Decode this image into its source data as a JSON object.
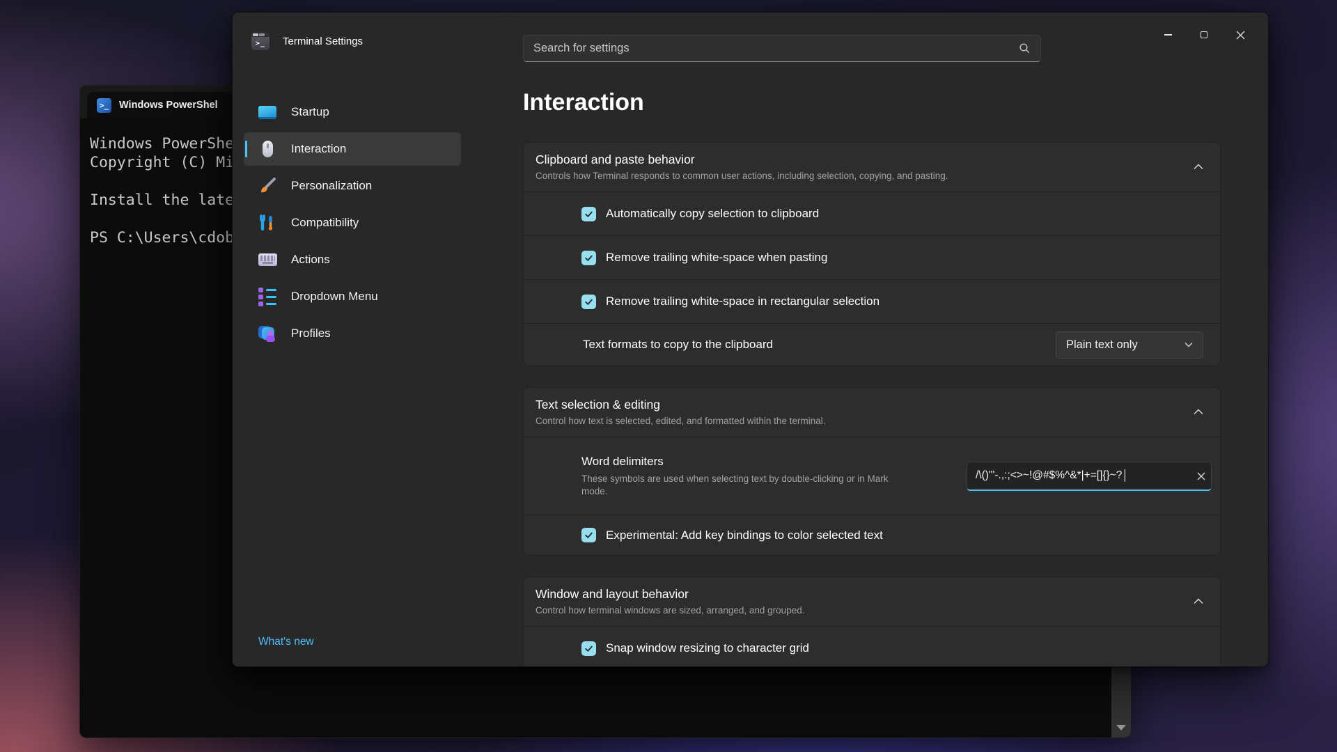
{
  "colors": {
    "accent": "#4cc2ff",
    "checkbox_fill": "#97dfef",
    "window_bg": "#282828",
    "card_bg": "#2d2d2d",
    "terminal_bg": "#0c0c0c"
  },
  "powershell": {
    "tab_title": "Windows PowerShel",
    "lines": [
      "Windows PowerShe",
      "Copyright (C) Mi",
      "",
      "Install the late",
      "",
      "PS C:\\Users\\cdob"
    ]
  },
  "titlebar": {
    "app_title": "Terminal Settings"
  },
  "search": {
    "placeholder": "Search for settings"
  },
  "sidebar": {
    "items": [
      {
        "label": "Startup",
        "icon": "monitor-icon",
        "selected": false
      },
      {
        "label": "Interaction",
        "icon": "mouse-icon",
        "selected": true
      },
      {
        "label": "Personalization",
        "icon": "paintbrush-icon",
        "selected": false
      },
      {
        "label": "Compatibility",
        "icon": "tools-icon",
        "selected": false
      },
      {
        "label": "Actions",
        "icon": "keyboard-icon",
        "selected": false
      },
      {
        "label": "Dropdown Menu",
        "icon": "list-icon",
        "selected": false
      },
      {
        "label": "Profiles",
        "icon": "profiles-icon",
        "selected": false
      }
    ],
    "whats_new_label": "What's new"
  },
  "page": {
    "title": "Interaction",
    "clipboard_card": {
      "title": "Clipboard and paste behavior",
      "subtitle": "Controls how Terminal responds to common user actions, including selection, copying, and pasting.",
      "rows": [
        {
          "label": "Automatically copy selection to clipboard",
          "checked": true
        },
        {
          "label": "Remove trailing white-space when pasting",
          "checked": true
        },
        {
          "label": "Remove trailing white-space in rectangular selection",
          "checked": true
        }
      ],
      "formats_row": {
        "label": "Text formats to copy to the clipboard",
        "value": "Plain text only"
      }
    },
    "selection_card": {
      "title": "Text selection & editing",
      "subtitle": "Control how text is selected, edited, and formatted within the terminal.",
      "word_delimiters": {
        "label": "Word delimiters",
        "description": "These symbols are used when selecting text by double-clicking or in Mark mode.",
        "value": "/\\()\"'-.,:;<>~!@#$%^&*|+=[]{}~?│"
      },
      "experimental_row": {
        "label": "Experimental: Add key bindings to color selected text",
        "checked": true
      }
    },
    "window_card": {
      "title": "Window and layout behavior",
      "subtitle": "Control how terminal windows are sized, arranged, and grouped.",
      "partial_row": {
        "label": "Snap window resizing to character grid",
        "checked": true
      }
    }
  }
}
